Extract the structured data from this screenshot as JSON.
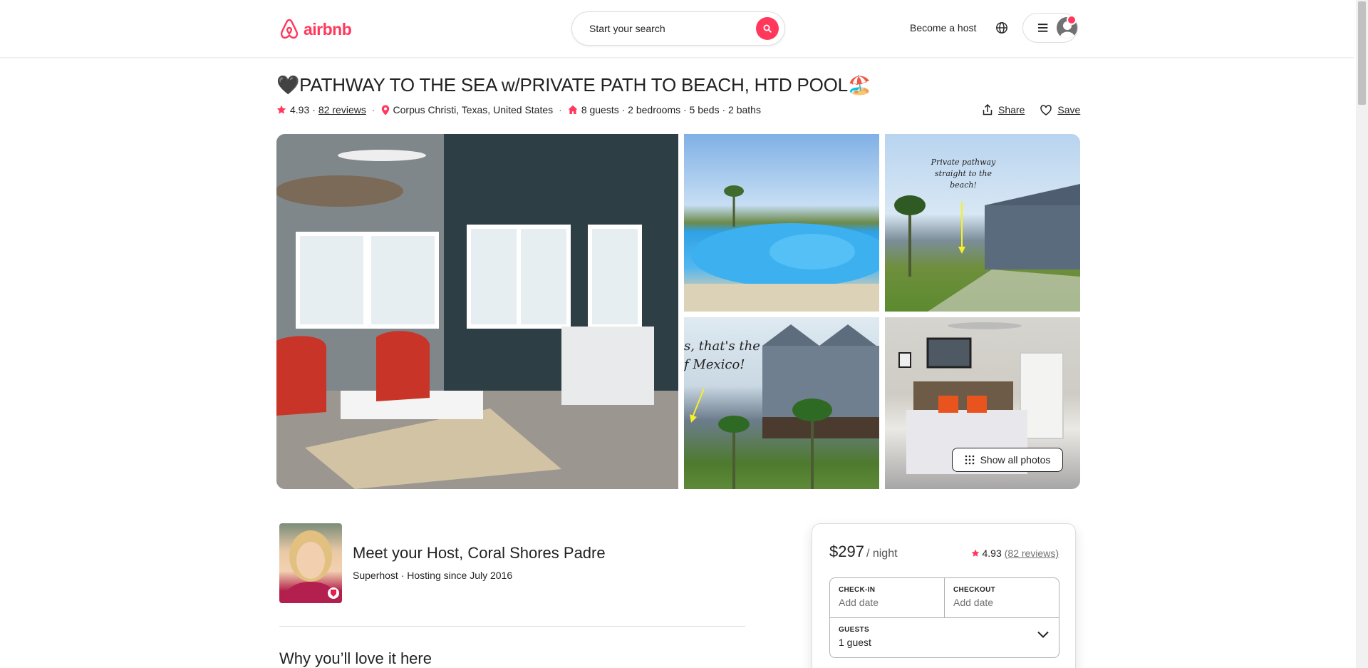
{
  "header": {
    "logo_text": "airbnb",
    "search_placeholder": "Start your search",
    "become_host": "Become a host"
  },
  "listing": {
    "title": "🖤PATHWAY TO THE SEA w/PRIVATE PATH TO BEACH, HTD POOL🏖️",
    "rating": "4.93",
    "reviews": "82 reviews",
    "location": "Corpus Christi, Texas, United States",
    "details": "8 guests · 2 bedrooms · 5 beds · 2 baths",
    "share": "Share",
    "save": "Save"
  },
  "gallery": {
    "photo3_text": "Private pathway straight to the beach!",
    "photo4_text": "s, that's the\nf Mexico!",
    "photo4_line1": "s, that's the",
    "photo4_line2": "f Mexico!",
    "show_all": "Show all photos"
  },
  "host": {
    "meet_prefix": "Meet your Host, ",
    "name": "Coral Shores Padre",
    "subtitle": "Superhost · Hosting since July 2016"
  },
  "section": {
    "why": "Why you’ll love it here"
  },
  "booking": {
    "price": "$297",
    "per_night": "/ night",
    "rating": "4.93",
    "reviews": "(82 reviews)",
    "checkin_label": "CHECK-IN",
    "checkin_value": "Add date",
    "checkout_label": "CHECKOUT",
    "checkout_value": "Add date",
    "guests_label": "GUESTS",
    "guests_value": "1 guest"
  },
  "colors": {
    "brand": "#ff385c",
    "text": "#222222",
    "muted": "#717171"
  }
}
